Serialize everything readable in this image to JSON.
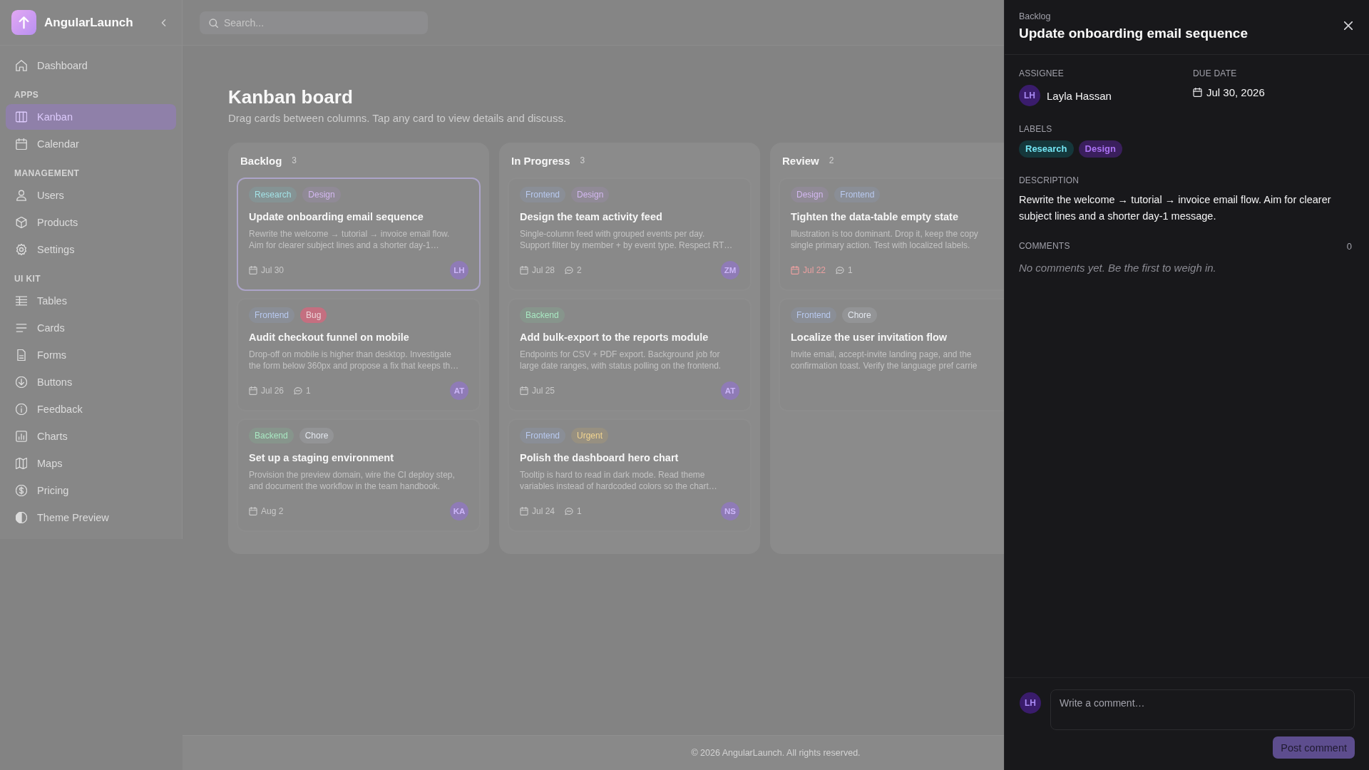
{
  "sidebar": {
    "brand": "AngularLaunch",
    "items": [
      {
        "kind": "link",
        "label": "Dashboard",
        "selected": false
      },
      {
        "kind": "section",
        "label": "APPS"
      },
      {
        "kind": "link",
        "label": "Kanban",
        "selected": true
      },
      {
        "kind": "link",
        "label": "Calendar",
        "selected": false
      },
      {
        "kind": "section",
        "label": "MANAGEMENT"
      },
      {
        "kind": "link",
        "label": "Users",
        "selected": false
      },
      {
        "kind": "link",
        "label": "Products",
        "selected": false
      },
      {
        "kind": "link",
        "label": "Settings",
        "selected": false
      },
      {
        "kind": "section",
        "label": "UI KIT"
      },
      {
        "kind": "link",
        "label": "Tables",
        "selected": false
      },
      {
        "kind": "link",
        "label": "Cards",
        "selected": false
      },
      {
        "kind": "link",
        "label": "Forms",
        "selected": false
      },
      {
        "kind": "link",
        "label": "Buttons",
        "selected": false
      },
      {
        "kind": "link",
        "label": "Feedback",
        "selected": false
      },
      {
        "kind": "link",
        "label": "Charts",
        "selected": false
      },
      {
        "kind": "link",
        "label": "Maps",
        "selected": false
      },
      {
        "kind": "link",
        "label": "Pricing",
        "selected": false
      },
      {
        "kind": "link",
        "label": "Theme Preview",
        "selected": false
      }
    ]
  },
  "topbar": {
    "search": {
      "placeholder": "Search..."
    }
  },
  "page": {
    "title": "Kanban board",
    "subtitle": "Drag cards between columns. Tap any card to view details and discuss."
  },
  "columns": [
    {
      "title": "Backlog",
      "count": "3",
      "cards": [
        {
          "tags": [
            {
              "text": "Research",
              "color": "#a3e2e6",
              "kind": "soft"
            },
            {
              "text": "Design",
              "color": "#d3b8f0",
              "kind": "soft"
            }
          ],
          "title": "Update onboarding email sequence",
          "description": [
            "Rewrite the welcome → tutorial → invoice email flow.",
            "Aim for clearer subject lines and a shorter day-1…"
          ],
          "due": "Jul 30",
          "overdue": false,
          "assignee": "LH",
          "selected": true
        },
        {
          "tags": [
            {
              "text": "Frontend",
              "color": "#b9caf0",
              "kind": "soft"
            },
            {
              "text": "Bug",
              "color": "#c46f80",
              "kind": "solid"
            }
          ],
          "title": "Audit checkout funnel on mobile",
          "description": [
            "Drop-off on mobile is higher than desktop. Investigate",
            "the form below 360px and propose a fix that keeps th…"
          ],
          "due": "Jul 26",
          "overdue": false,
          "comments": "1",
          "assignee": "AT",
          "selected": false
        },
        {
          "tags": [
            {
              "text": "Backend",
              "color": "#a9e8c2",
              "kind": "soft"
            },
            {
              "text": "Chore",
              "color": "#e3e7ee",
              "kind": "soft"
            }
          ],
          "title": "Set up a staging environment",
          "description": [
            "Provision the preview domain, wire the CI deploy step,",
            "and document the workflow in the team handbook."
          ],
          "due": "Aug 2",
          "overdue": false,
          "assignee": "KA",
          "selected": false
        }
      ]
    },
    {
      "title": "In Progress",
      "count": "3",
      "cards": [
        {
          "tags": [
            {
              "text": "Frontend",
              "color": "#b9caf0",
              "kind": "soft"
            },
            {
              "text": "Design",
              "color": "#d3b8f0",
              "kind": "soft"
            }
          ],
          "title": "Design the team activity feed",
          "description": [
            "Single-column feed with grouped events per day.",
            "Support filter by member + by event type. Respect RT…"
          ],
          "due": "Jul 28",
          "overdue": false,
          "comments": "2",
          "assignee": "ZM",
          "selected": false
        },
        {
          "tags": [
            {
              "text": "Backend",
              "color": "#a9e8c2",
              "kind": "soft"
            }
          ],
          "title": "Add bulk-export to the reports module",
          "description": [
            "Endpoints for CSV + PDF export. Background job for",
            "large date ranges, with status polling on the frontend."
          ],
          "due": "Jul 25",
          "overdue": false,
          "assignee": "AT",
          "selected": false
        },
        {
          "tags": [
            {
              "text": "Frontend",
              "color": "#b9caf0",
              "kind": "soft"
            },
            {
              "text": "Urgent",
              "color": "#f2d591",
              "kind": "soft"
            }
          ],
          "title": "Polish the dashboard hero chart",
          "description": [
            "Tooltip is hard to read in dark mode. Read theme",
            "variables instead of hardcoded colors so the chart…"
          ],
          "due": "Jul 24",
          "overdue": false,
          "comments": "1",
          "assignee": "NS",
          "selected": false
        }
      ]
    },
    {
      "title": "Review",
      "count": "2",
      "cards": [
        {
          "tags": [
            {
              "text": "Design",
              "color": "#d3b8f0",
              "kind": "soft"
            },
            {
              "text": "Frontend",
              "color": "#b9caf0",
              "kind": "soft"
            }
          ],
          "title": "Tighten the data-table empty state",
          "description": [
            "Illustration is too dominant. Drop it, keep the copy",
            "single primary action. Test with localized labels."
          ],
          "due": "Jul 22",
          "overdue": true,
          "comments": "1",
          "selected": false
        },
        {
          "tags": [
            {
              "text": "Frontend",
              "color": "#b9caf0",
              "kind": "soft"
            },
            {
              "text": "Chore",
              "color": "#e3e7ee",
              "kind": "soft"
            }
          ],
          "title": "Localize the user invitation flow",
          "description": [
            "Invite email, accept-invite landing page, and the",
            "confirmation toast. Verify the language pref carrie"
          ],
          "selected": false
        }
      ]
    }
  ],
  "footer": "© 2026 AngularLaunch. All rights reserved.",
  "detail": {
    "column": "Backlog",
    "title": "Update onboarding email sequence",
    "assignee_label": "ASSIGNEE",
    "assignee": {
      "initials": "LH",
      "name": "Layla Hassan"
    },
    "due_label": "DUE DATE",
    "due": "Jul 30, 2026",
    "labels_label": "LABELS",
    "labels": [
      {
        "text": "Research",
        "color": "#15373b"
      },
      {
        "text": "Design",
        "color": "#3a1f5c"
      }
    ],
    "description_label": "DESCRIPTION",
    "description": "Rewrite the welcome → tutorial → invoice email flow. Aim for clearer subject lines and a shorter day-1 message.",
    "comments_label": "COMMENTS",
    "comment_count": "0",
    "empty_comments": "No comments yet. Be the first to weigh in.",
    "composer": {
      "initials": "LH",
      "placeholder": "Write a comment…",
      "post_button": {
        "label": "Post comment",
        "disabled": true
      }
    }
  }
}
